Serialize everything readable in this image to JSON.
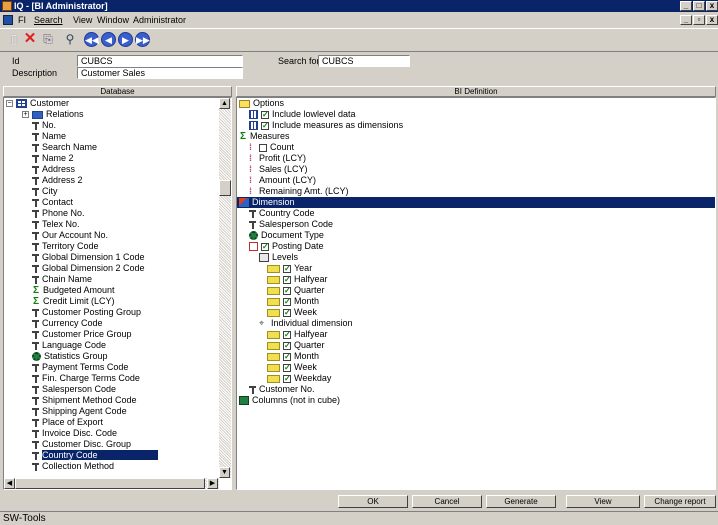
{
  "window": {
    "title": "IQ - [BI Administrator]"
  },
  "menu": [
    "FI",
    "Search",
    "View",
    "Window",
    "Administrator"
  ],
  "header": {
    "id_label": "Id",
    "id_value": "CUBCS",
    "description_label": "Description",
    "description_value": "Customer Sales",
    "search_label": "Search for",
    "search_value": "CUBCS"
  },
  "left_panel": {
    "header": "Database",
    "root": "Customer",
    "relations": "Relations",
    "fields": [
      {
        "label": "No.",
        "icon": "key"
      },
      {
        "label": "Name",
        "icon": "key"
      },
      {
        "label": "Search Name",
        "icon": "key"
      },
      {
        "label": "Name 2",
        "icon": "key"
      },
      {
        "label": "Address",
        "icon": "key"
      },
      {
        "label": "Address 2",
        "icon": "key"
      },
      {
        "label": "City",
        "icon": "key"
      },
      {
        "label": "Contact",
        "icon": "key"
      },
      {
        "label": "Phone No.",
        "icon": "key"
      },
      {
        "label": "Telex No.",
        "icon": "key"
      },
      {
        "label": "Our Account No.",
        "icon": "key"
      },
      {
        "label": "Territory Code",
        "icon": "key"
      },
      {
        "label": "Global Dimension 1 Code",
        "icon": "key"
      },
      {
        "label": "Global Dimension 2 Code",
        "icon": "key"
      },
      {
        "label": "Chain Name",
        "icon": "key"
      },
      {
        "label": "Budgeted Amount",
        "icon": "sigma"
      },
      {
        "label": "Credit Limit (LCY)",
        "icon": "sigma"
      },
      {
        "label": "Customer Posting Group",
        "icon": "key"
      },
      {
        "label": "Currency Code",
        "icon": "key"
      },
      {
        "label": "Customer Price Group",
        "icon": "key"
      },
      {
        "label": "Language Code",
        "icon": "key"
      },
      {
        "label": "Statistics Group",
        "icon": "gear"
      },
      {
        "label": "Payment Terms Code",
        "icon": "key"
      },
      {
        "label": "Fin. Charge Terms Code",
        "icon": "key"
      },
      {
        "label": "Salesperson Code",
        "icon": "key"
      },
      {
        "label": "Shipment Method Code",
        "icon": "key"
      },
      {
        "label": "Shipping Agent Code",
        "icon": "key"
      },
      {
        "label": "Place of Export",
        "icon": "key"
      },
      {
        "label": "Invoice Disc. Code",
        "icon": "key"
      },
      {
        "label": "Customer Disc. Group",
        "icon": "key"
      },
      {
        "label": "Country Code",
        "icon": "key",
        "selected": true
      },
      {
        "label": "Collection Method",
        "icon": "key"
      }
    ]
  },
  "right_panel": {
    "header": "BI Definition",
    "rows": [
      {
        "label": "Options",
        "icon": "folder",
        "indent": 0
      },
      {
        "label": "Include lowlevel data",
        "icon": "grid-check",
        "indent": 1
      },
      {
        "label": "Include measures as dimensions",
        "icon": "grid-check",
        "indent": 1
      },
      {
        "label": "Measures",
        "icon": "sigma",
        "indent": 0
      },
      {
        "label": "Count",
        "icon": "measure-uncheck",
        "indent": 1
      },
      {
        "label": "Profit (LCY)",
        "icon": "measure",
        "indent": 1
      },
      {
        "label": "Sales (LCY)",
        "icon": "measure",
        "indent": 1
      },
      {
        "label": "Amount (LCY)",
        "icon": "measure",
        "indent": 1
      },
      {
        "label": "Remaining Amt. (LCY)",
        "icon": "measure",
        "indent": 1
      },
      {
        "label": "Dimension",
        "icon": "dim",
        "indent": 0,
        "selected": true
      },
      {
        "label": "Country Code",
        "icon": "key",
        "indent": 1
      },
      {
        "label": "Salesperson Code",
        "icon": "key",
        "indent": 1
      },
      {
        "label": "Document Type",
        "icon": "gear",
        "indent": 1
      },
      {
        "label": "Posting Date",
        "icon": "cal-check",
        "indent": 1
      },
      {
        "label": "Levels",
        "icon": "levels",
        "indent": 2
      },
      {
        "label": "Year",
        "icon": "fold-check",
        "indent": 3
      },
      {
        "label": "Halfyear",
        "icon": "fold-check",
        "indent": 3
      },
      {
        "label": "Quarter",
        "icon": "fold-check",
        "indent": 3
      },
      {
        "label": "Month",
        "icon": "fold-check",
        "indent": 3
      },
      {
        "label": "Week",
        "icon": "fold-check",
        "indent": 3
      },
      {
        "label": "Individual dimension",
        "icon": "indiv",
        "indent": 2
      },
      {
        "label": "Halfyear",
        "icon": "fold-check",
        "indent": 3
      },
      {
        "label": "Quarter",
        "icon": "fold-check",
        "indent": 3
      },
      {
        "label": "Month",
        "icon": "fold-check",
        "indent": 3
      },
      {
        "label": "Week",
        "icon": "fold-check",
        "indent": 3
      },
      {
        "label": "Weekday",
        "icon": "fold-check",
        "indent": 3
      },
      {
        "label": "Customer No.",
        "icon": "key",
        "indent": 1
      },
      {
        "label": "Columns (not in cube)",
        "icon": "colgrid",
        "indent": 0
      }
    ]
  },
  "buttons": {
    "ok": "OK",
    "cancel": "Cancel",
    "generate": "Generate",
    "view": "View",
    "change_report": "Change report"
  },
  "status": "SW-Tools",
  "colors": {
    "title_bar": "#0a246a",
    "selection": "#0a246a",
    "face": "#d4d0c8"
  }
}
